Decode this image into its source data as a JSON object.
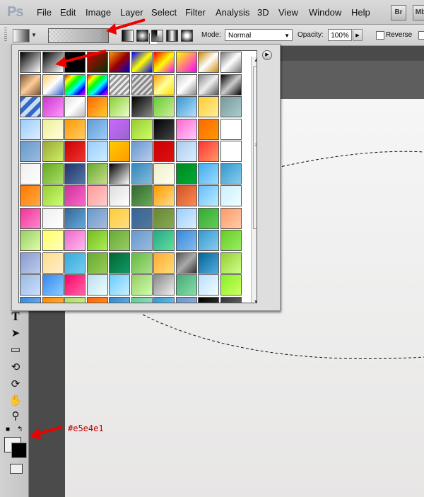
{
  "menu": {
    "logo": "Ps",
    "items": [
      "File",
      "Edit",
      "Image",
      "Layer",
      "Select",
      "Filter",
      "Analysis",
      "3D",
      "View",
      "Window",
      "Help"
    ],
    "bridge": "Br",
    "minibridge": "Mb"
  },
  "options": {
    "mode_label": "Mode:",
    "mode_value": "Normal",
    "opacity_label": "Opacity:",
    "opacity_value": "100%",
    "reverse_label": "Reverse"
  },
  "annotation": {
    "color_hex": "#e5e4e1"
  },
  "gradient_presets": [
    "linear-gradient(135deg,#000,#fff)",
    "linear-gradient(135deg,#000,rgba(0,0,0,0))",
    "linear-gradient(135deg,#000,#000)",
    "linear-gradient(135deg,#c00,#030)",
    "linear-gradient(135deg,#f90,#900 50%,#00c)",
    "linear-gradient(135deg,#00f,#ff0 50%,#00f)",
    "linear-gradient(135deg,#f00,#ff0 50%,#f0f)",
    "linear-gradient(135deg,#ff0,#f0f)",
    "linear-gradient(135deg,#c80,#fff 50%,#c80)",
    "linear-gradient(135deg,#777,#fff 50%,#777)",
    "linear-gradient(135deg,#753,#fc9 50%,#753)",
    "linear-gradient(135deg,#fc6,#fff 50%,#36c)",
    "linear-gradient(135deg,#f00,#ff0,#0f0,#0ff,#00f,#f0f)",
    "linear-gradient(135deg,#f00,#ff0,#0f0,#0ff,#00f,#f0f)",
    "repeating-linear-gradient(135deg,#999 0 3px,#eee 3px 6px)",
    "repeating-linear-gradient(135deg,#888 0 3px,#ddd 3px 6px)",
    "linear-gradient(135deg,#f90,#ff9 50%,#fd0)",
    "linear-gradient(135deg,#ccc,#fff 50%,#888)",
    "linear-gradient(135deg,#888,#eee 50%,#555)",
    "linear-gradient(135deg,#000,#ccc 50%,#000)",
    "repeating-linear-gradient(135deg,#36c 0 6px,#cde 6px 12px)",
    "linear-gradient(135deg,#c3c,#f9f)",
    "linear-gradient(135deg,#ddd,#fff 50%,#bbb)",
    "linear-gradient(135deg,#f60,#fc3)",
    "linear-gradient(135deg,#8c3,#efc)",
    "linear-gradient(135deg,#000,#888)",
    "linear-gradient(135deg,#6c3,#ce9)",
    "linear-gradient(135deg,#39c,#bdf)",
    "linear-gradient(135deg,#fc3,#fe9)",
    "linear-gradient(135deg,#799,#acc)",
    "linear-gradient(135deg,#9cf,#def)",
    "linear-gradient(135deg,#ee9,#ffd)",
    "linear-gradient(135deg,#f90,#fc6)",
    "linear-gradient(135deg,#69c,#9cf)",
    "linear-gradient(135deg,#c6f,#96c)",
    "linear-gradient(135deg,#9c3,#cf6)",
    "linear-gradient(135deg,#000,#444)",
    "linear-gradient(135deg,#f6c,#fcf)",
    "linear-gradient(135deg,#f60,#f90)",
    "linear-gradient(135deg,#fff,#fff)",
    "linear-gradient(135deg,#69c,#9bd)",
    "linear-gradient(135deg,#9a3,#ce6)",
    "linear-gradient(135deg,#c00,#e33)",
    "linear-gradient(135deg,#9cf,#cef)",
    "linear-gradient(135deg,#fc0,#f90)",
    "linear-gradient(135deg,#69c,#bce)",
    "linear-gradient(135deg,#c00,#d11)",
    "linear-gradient(135deg,#ace,#def)",
    "linear-gradient(135deg,#f33,#f96)",
    "linear-gradient(135deg,#fff,#fff)",
    "linear-gradient(135deg,#eee,#fff)",
    "linear-gradient(135deg,#6a2,#ad6)",
    "linear-gradient(135deg,#236,#57a)",
    "linear-gradient(135deg,#6a3,#cd8)",
    "linear-gradient(135deg,#000,#fff)",
    "linear-gradient(135deg,#38b,#8bd)",
    "linear-gradient(135deg,#eec,#ffe)",
    "linear-gradient(135deg,#082,#0a3)",
    "linear-gradient(135deg,#4ae,#9df)",
    "linear-gradient(135deg,#39c,#8ce)",
    "linear-gradient(135deg,#f70,#fa4)",
    "linear-gradient(135deg,#9c3,#cf7)",
    "linear-gradient(135deg,#c39,#f6c)",
    "linear-gradient(135deg,#f99,#fcc)",
    "linear-gradient(135deg,#ddd,#fff)",
    "linear-gradient(135deg,#363,#6a5)",
    "linear-gradient(135deg,#f90,#fd8)",
    "linear-gradient(135deg,#c52,#f85)",
    "linear-gradient(135deg,#6bf,#bef)",
    "linear-gradient(135deg,#cef,#eff)",
    "linear-gradient(135deg,#e39,#f8c)",
    "linear-gradient(135deg,#eee,#fff)",
    "linear-gradient(135deg,#369,#6ad)",
    "linear-gradient(135deg,#69c,#abd)",
    "linear-gradient(135deg,#fc3,#fd8)",
    "linear-gradient(135deg,#369,#579)",
    "linear-gradient(135deg,#683,#8a5)",
    "linear-gradient(135deg,#9cf,#def)",
    "linear-gradient(135deg,#3a3,#6c5)",
    "linear-gradient(135deg,#f96,#fca)",
    "linear-gradient(135deg,#9c6,#dfa)",
    "linear-gradient(135deg,#ff6,#ffb)",
    "linear-gradient(135deg,#e6c,#fbe)",
    "linear-gradient(135deg,#7b2,#ae5)",
    "linear-gradient(135deg,#6a3,#9c6)",
    "linear-gradient(135deg,#69c,#9bd)",
    "linear-gradient(135deg,#2a8,#6d9)",
    "linear-gradient(135deg,#38d,#8be)",
    "linear-gradient(135deg,#39c,#8ce)",
    "linear-gradient(135deg,#6c2,#9e6)",
    "linear-gradient(135deg,#89c,#bce)",
    "linear-gradient(135deg,#fd8,#fec)",
    "linear-gradient(135deg,#3ad,#7ce)",
    "linear-gradient(135deg,#6a3,#9c5)",
    "linear-gradient(135deg,#063,#196)",
    "linear-gradient(135deg,#6b4,#ad8)",
    "linear-gradient(135deg,#fa3,#fd7)",
    "linear-gradient(135deg,#555,#aaa 50%,#333)",
    "linear-gradient(135deg,#069,#5ad)",
    "linear-gradient(135deg,#9c3,#cf8)",
    "linear-gradient(135deg,#9bd,#cdf)",
    "linear-gradient(135deg,#38e,#8cf)",
    "linear-gradient(135deg,#f06,#f6a)",
    "linear-gradient(135deg,#bde,#eff)",
    "linear-gradient(135deg,#6cf,#cef)",
    "linear-gradient(135deg,#9c6,#cfa)",
    "linear-gradient(135deg,#888,#eee)",
    "linear-gradient(135deg,#4a7,#8da)",
    "linear-gradient(135deg,#bdf,#eff)",
    "linear-gradient(135deg,#8e2,#cf6)",
    "linear-gradient(135deg,#38d,#8be)",
    "linear-gradient(135deg,#f80,#fb5)",
    "linear-gradient(135deg,#ad6,#de9)",
    "linear-gradient(135deg,#f60,#f93)",
    "linear-gradient(135deg,#38c,#7be)",
    "linear-gradient(135deg,#6c8,#ade)",
    "linear-gradient(135deg,#39c,#8cf)",
    "linear-gradient(135deg,#69c,#aad)",
    "linear-gradient(135deg,#000,#444)",
    "linear-gradient(135deg,#333,#777)"
  ]
}
